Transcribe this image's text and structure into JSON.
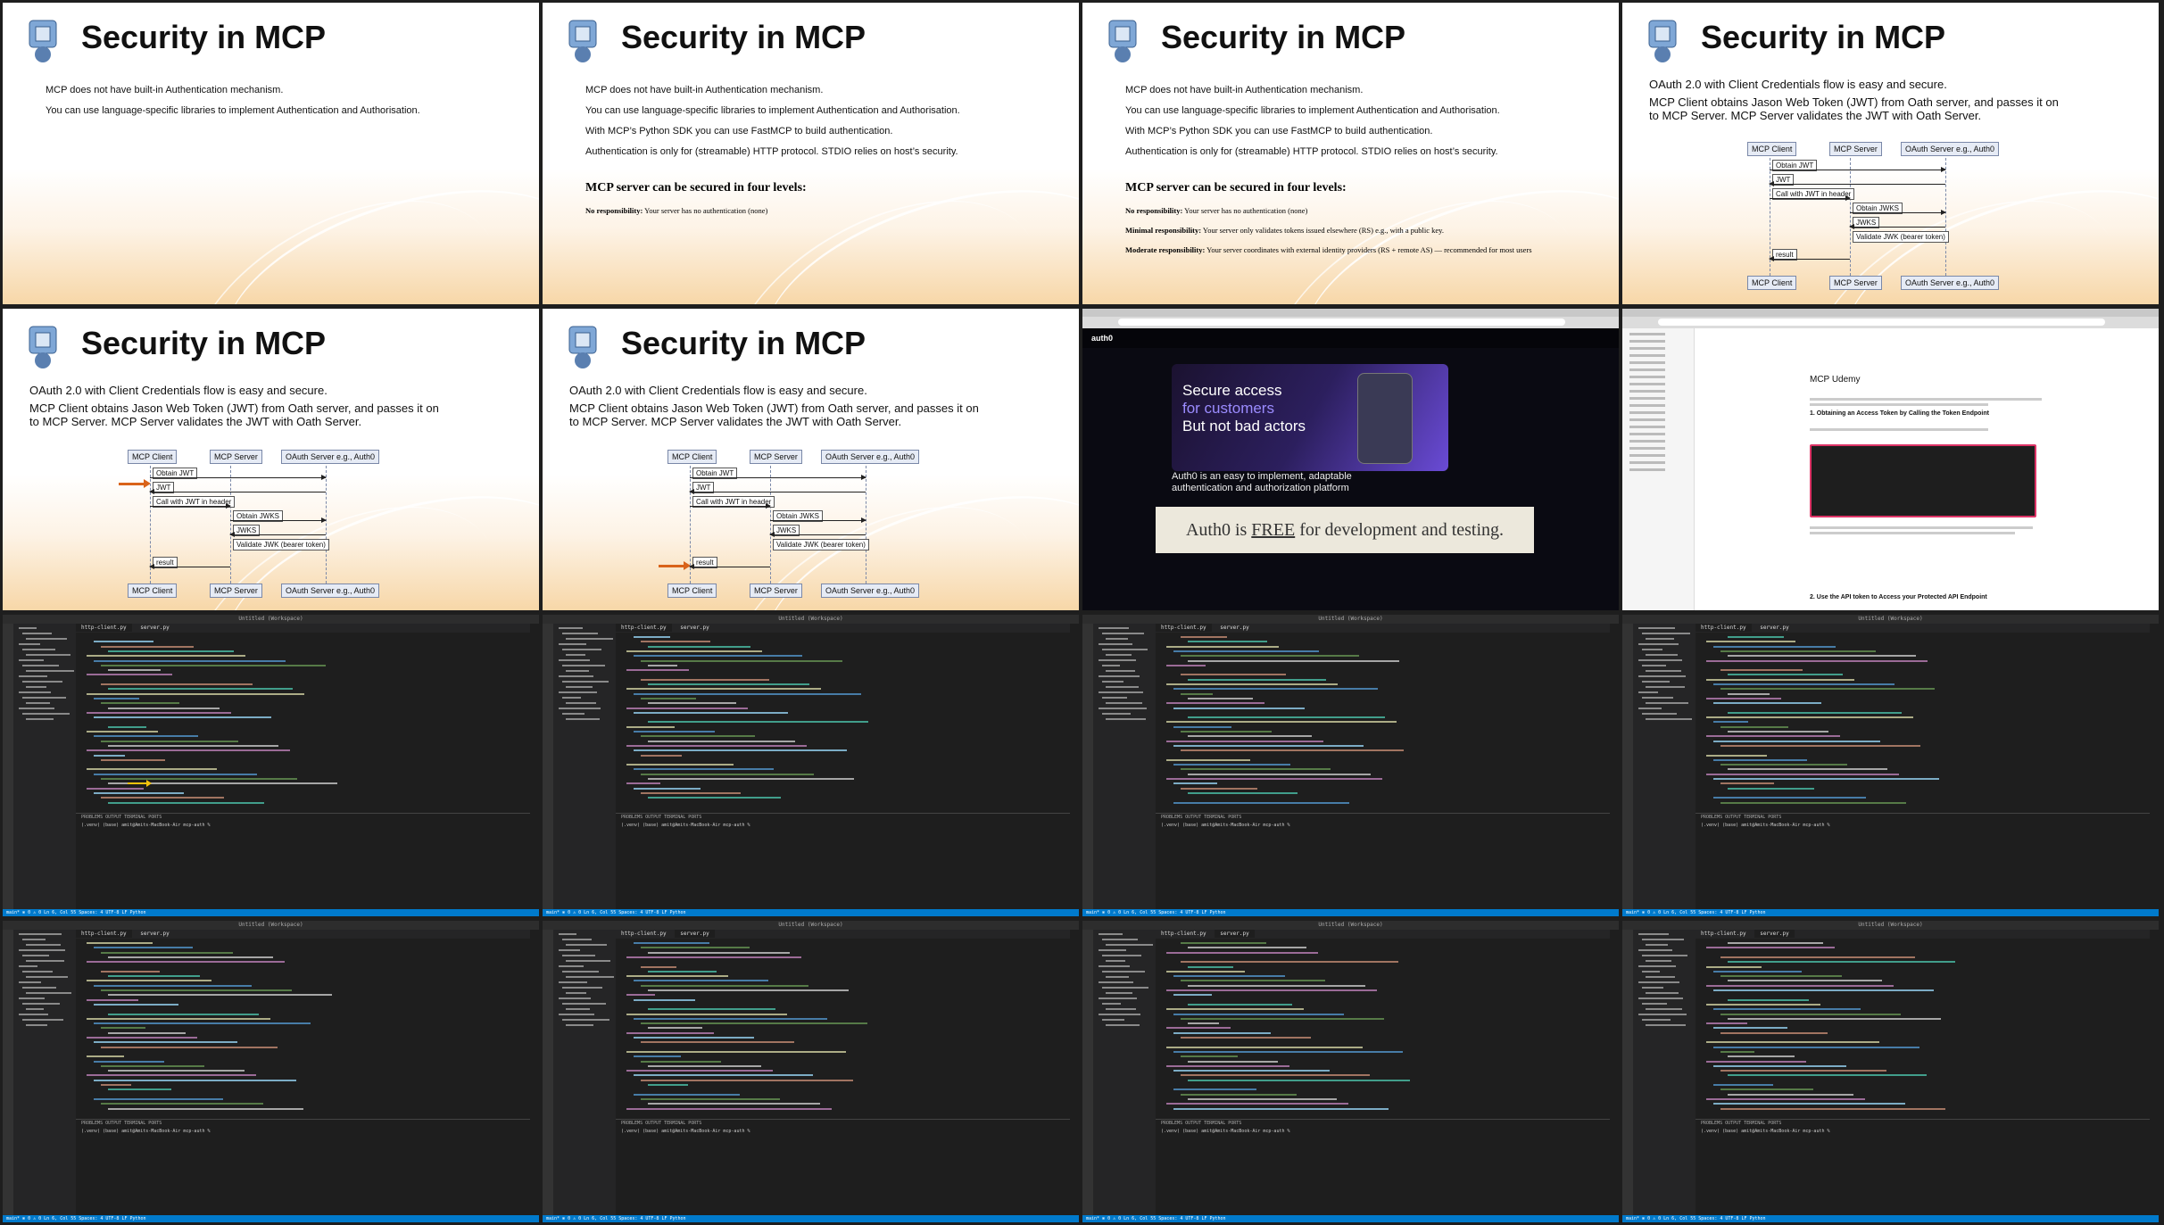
{
  "slides": {
    "title": "Security in MCP",
    "intro_lines": [
      "MCP does not have built-in Authentication mechanism.",
      "You can use language-specific libraries to implement Authentication and Authorisation.",
      "With MCP’s Python SDK you can use FastMCP to build authentication.",
      "Authentication is only for (streamable) HTTP protocol. STDIO relies on host’s security."
    ],
    "levels_heading": "MCP server can be secured in four levels:",
    "levels": [
      {
        "name": "No responsibility:",
        "desc": "Your server has no authentication (none)"
      },
      {
        "name": "Minimal responsibility:",
        "desc": "Your server only validates tokens issued elsewhere (RS) e.g., with a public key."
      },
      {
        "name": "Moderate responsibility:",
        "desc": "Your server coordinates with external identity providers (RS + remote AS) — recommended for most users"
      }
    ],
    "oauth_lines": [
      "OAuth 2.0 with Client Credentials flow is easy and secure.",
      "MCP Client obtains Jason Web Token (JWT) from Oath server, and passes it on to MCP Server. MCP Server validates the JWT with Oath Server."
    ],
    "diagram": {
      "participants": [
        "MCP Client",
        "MCP Server",
        "OAuth Server e.g., Auth0"
      ],
      "messages": [
        "Obtain JWT",
        "JWT",
        "Call with JWT in header",
        "Obtain JWKS",
        "JWKS",
        "Validate JWK (bearer token)",
        "result"
      ]
    }
  },
  "browser": {
    "auth0": {
      "brand": "auth0",
      "hero_line1": "Secure access",
      "hero_line2": "for customers",
      "hero_line3": "But not bad actors",
      "subtitle": "Auth0 is an easy to implement, adaptable authentication and authorization platform",
      "callout_pre": "Auth0 is ",
      "callout_free": "FREE",
      "callout_post": " for development and testing."
    },
    "docs": {
      "title": "MCP Udemy",
      "step1": "1. Obtaining an Access Token by Calling the Token Endpoint",
      "step2": "2. Use the API token to Access your Protected API Endpoint"
    }
  },
  "vscode": {
    "window_title": "Untitled (Workspace)",
    "tabs": [
      "http-client.py",
      "server.py"
    ],
    "panel_tabs": "PROBLEMS   OUTPUT   TERMINAL   PORTS",
    "terminal": "(.venv) (base) amit@Amits-MacBook-Air mcp-auth %",
    "status": "main*   ⊗ 0 ⚠ 0   Ln 6, Col 55   Spaces: 4   UTF-8   LF   Python"
  }
}
